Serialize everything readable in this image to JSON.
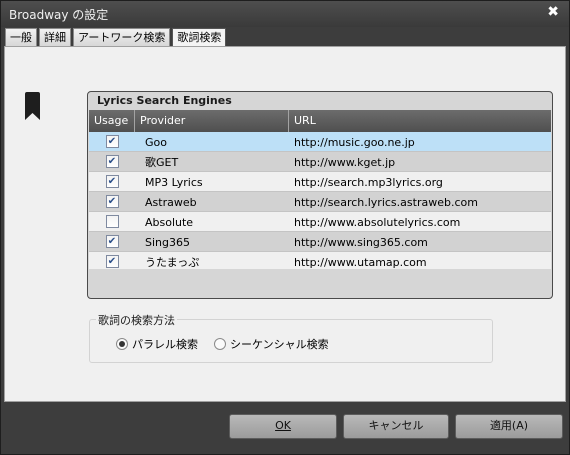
{
  "window": {
    "title": "Broadway の設定",
    "close_glyph": "✖"
  },
  "tabs": [
    {
      "label": "一般",
      "active": false
    },
    {
      "label": "詳細",
      "active": false
    },
    {
      "label": "アートワーク検索",
      "active": false
    },
    {
      "label": "歌詞検索",
      "active": true
    }
  ],
  "icons": {
    "bookmark": "bookmark-icon"
  },
  "engines": {
    "title": "Lyrics Search Engines",
    "columns": {
      "usage": "Usage",
      "provider": "Provider",
      "url": "URL"
    },
    "rows": [
      {
        "checked": true,
        "provider": "Goo",
        "url": "http://music.goo.ne.jp"
      },
      {
        "checked": true,
        "provider": "歌GET",
        "url": "http://www.kget.jp"
      },
      {
        "checked": true,
        "provider": "MP3 Lyrics",
        "url": "http://search.mp3lyrics.org"
      },
      {
        "checked": true,
        "provider": "Astraweb",
        "url": "http://search.lyrics.astraweb.com"
      },
      {
        "checked": false,
        "provider": "Absolute",
        "url": "http://www.absolutelyrics.com"
      },
      {
        "checked": true,
        "provider": "Sing365",
        "url": "http://www.sing365.com"
      },
      {
        "checked": true,
        "provider": "うたまっぷ",
        "url": "http://www.utamap.com"
      }
    ],
    "selected_row": 0
  },
  "method": {
    "title": "歌詞の検索方法",
    "options": [
      {
        "label": "パラレル検索",
        "selected": true
      },
      {
        "label": "シーケンシャル検索",
        "selected": false
      }
    ]
  },
  "buttons": {
    "ok": "OK",
    "cancel": "キャンセル",
    "apply": "適用(A)"
  },
  "colors": {
    "selection": "#bde0f7",
    "header": "#5a5a5a"
  }
}
